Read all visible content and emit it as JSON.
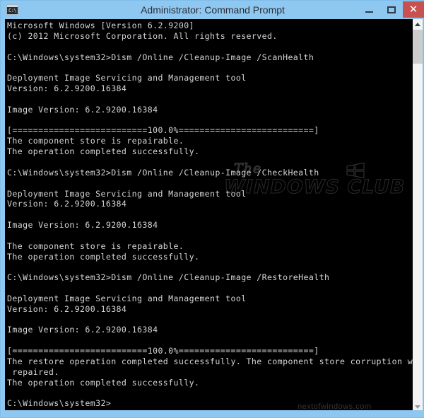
{
  "window": {
    "title": "Administrator: Command Prompt",
    "icon_name": "command-prompt-icon",
    "icon_glyph": "C:\\",
    "frame_color": "#8ec7f0",
    "console_bg": "#000000",
    "console_fg": "#d6d6d6"
  },
  "caption_buttons": {
    "minimize_label": "—",
    "maximize_label": "□",
    "close_label": "✕",
    "close_color": "#c75050"
  },
  "console": {
    "lines": [
      "Microsoft Windows [Version 6.2.9200]",
      "(c) 2012 Microsoft Corporation. All rights reserved.",
      "",
      "C:\\Windows\\system32>Dism /Online /Cleanup-Image /ScanHealth",
      "",
      "Deployment Image Servicing and Management tool",
      "Version: 6.2.9200.16384",
      "",
      "Image Version: 6.2.9200.16384",
      "",
      "[==========================100.0%==========================]",
      "The component store is repairable.",
      "The operation completed successfully.",
      "",
      "C:\\Windows\\system32>Dism /Online /Cleanup-Image /CheckHealth",
      "",
      "Deployment Image Servicing and Management tool",
      "Version: 6.2.9200.16384",
      "",
      "Image Version: 6.2.9200.16384",
      "",
      "The component store is repairable.",
      "The operation completed successfully.",
      "",
      "C:\\Windows\\system32>Dism /Online /Cleanup-Image /RestoreHealth",
      "",
      "Deployment Image Servicing and Management tool",
      "Version: 6.2.9200.16384",
      "",
      "Image Version: 6.2.9200.16384",
      "",
      "[==========================100.0%==========================]",
      "The restore operation completed successfully. The component store corruption was",
      " repaired.",
      "The operation completed successfully.",
      "",
      "C:\\Windows\\system32>"
    ]
  },
  "watermark": {
    "line1": "The",
    "line2": "WINDOWS CLUB",
    "logo_name": "windows-logo-icon",
    "bottom_text": "nextofwindows.com"
  },
  "scrollbar": {
    "up_arrow": "▲",
    "down_arrow": "▼",
    "thumb_name": "scrollbar-thumb"
  }
}
